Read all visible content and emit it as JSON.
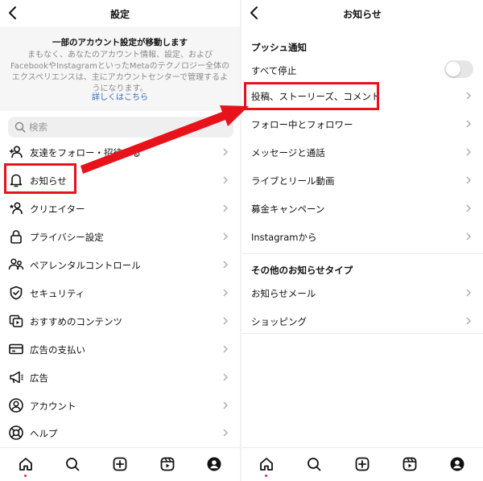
{
  "left": {
    "title": "設定",
    "notice": {
      "title": "一部のアカウント設定が移動します",
      "body": "まもなく、あなたのアカウント情報、設定、およびFacebookやInstagramといったMetaのテクノロジー全体のエクスペリエンスは、主にアカウントセンターで管理するようになります。",
      "link": "詳しくはこちら"
    },
    "search_placeholder": "検索",
    "items": [
      {
        "label": "友達をフォロー・招待する",
        "icon": "add-person-icon"
      },
      {
        "label": "お知らせ",
        "icon": "bell-icon"
      },
      {
        "label": "クリエイター",
        "icon": "star-person-icon"
      },
      {
        "label": "プライバシー設定",
        "icon": "lock-icon"
      },
      {
        "label": "ペアレンタルコントロール",
        "icon": "parental-icon"
      },
      {
        "label": "セキュリティ",
        "icon": "shield-icon"
      },
      {
        "label": "おすすめのコンテンツ",
        "icon": "recommended-content-icon"
      },
      {
        "label": "広告の支払い",
        "icon": "credit-card-icon"
      },
      {
        "label": "広告",
        "icon": "megaphone-icon"
      },
      {
        "label": "アカウント",
        "icon": "account-icon"
      },
      {
        "label": "ヘルプ",
        "icon": "lifebuoy-icon"
      }
    ]
  },
  "right": {
    "title": "お知らせ",
    "section1": "プッシュ通知",
    "pause_all": {
      "label": "すべて停止",
      "on": false
    },
    "items1": [
      {
        "label": "投稿、ストーリーズ、コメント"
      },
      {
        "label": "フォロー中とフォロワー"
      },
      {
        "label": "メッセージと通話"
      },
      {
        "label": "ライブとリール動画"
      },
      {
        "label": "募金キャンペーン"
      },
      {
        "label": "Instagramから"
      }
    ],
    "section2": "その他のお知らせタイプ",
    "items2": [
      {
        "label": "お知らせメール"
      },
      {
        "label": "ショッピング"
      }
    ]
  },
  "tabbar": [
    "home-icon",
    "search-icon",
    "create-icon",
    "reels-icon",
    "profile-icon"
  ],
  "colors": {
    "highlight": "#e8121b",
    "link": "#2a67c4",
    "badge_dot": "#e0245e"
  }
}
